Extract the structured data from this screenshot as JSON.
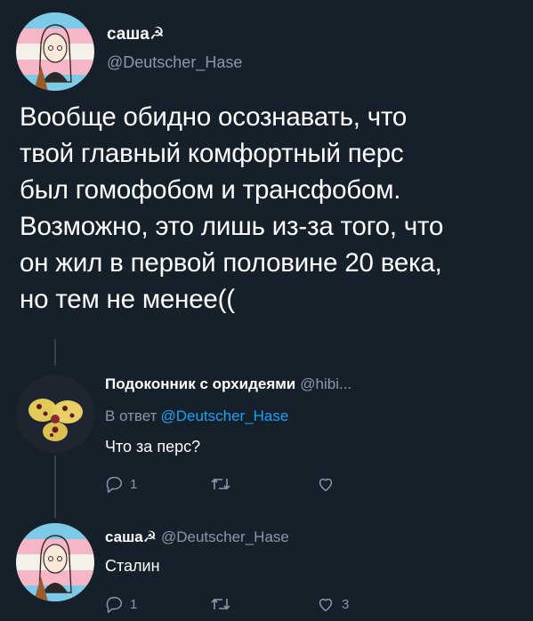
{
  "main_tweet": {
    "display_name": "саша☭",
    "handle": "@Deutscher_Hase",
    "text_lines": [
      "Вообще обидно осознавать, что",
      "твой главный комфортный перс",
      "был гомофобом и трансфобом.",
      "Возможно, это лишь из-за того, что",
      "он жил в первой половине 20 века,",
      "но тем не менее(("
    ]
  },
  "reply": {
    "display_name": "Подоконник с орхидеями",
    "handle": "@hibi...",
    "reply_prefix": "В ответ",
    "reply_to": "@Deutscher_Hase",
    "text": "Что за перс?",
    "reply_count": "1",
    "retweet_count": "",
    "like_count": ""
  },
  "reply2": {
    "display_name": "саша☭",
    "handle": "@Deutscher_Hase",
    "text": "Сталин",
    "reply_count": "1",
    "retweet_count": "",
    "like_count": "3"
  },
  "colors": {
    "background": "#15202b",
    "text_primary": "#ffffff",
    "text_secondary": "#8899a6",
    "link": "#1da1f2",
    "thread_line": "#38444d"
  }
}
